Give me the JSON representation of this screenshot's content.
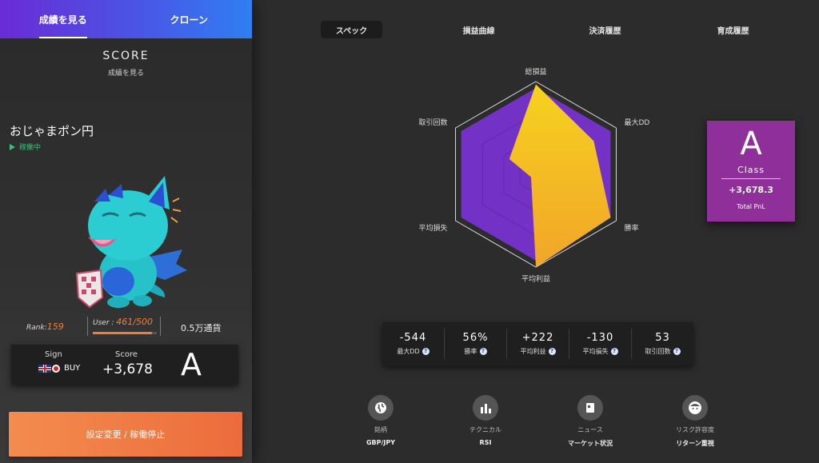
{
  "left_tabs": {
    "tab1": "成績を見る",
    "tab2": "クローン"
  },
  "score_header": {
    "title": "SCORE",
    "subtitle": "成績を見る"
  },
  "bot": {
    "name": "おじゃまポン円",
    "status": "稼働中"
  },
  "rank": {
    "label": "Rank:",
    "value": "159"
  },
  "user": {
    "label": "User : ",
    "value": "461/500",
    "fill_fraction": 0.922
  },
  "currency": "0.5万通貨",
  "sign_card": {
    "sign_label": "Sign",
    "sign_value": "BUY",
    "score_label": "Score",
    "score_value": "+3,678",
    "grade": "A"
  },
  "action_button": "設定変更 / 稼働停止",
  "right_tabs": {
    "spec": "スペック",
    "pnl_curve": "損益曲線",
    "history": "決済履歴",
    "training": "育成履歴"
  },
  "radar": {
    "labels": {
      "top": "総損益",
      "top_right": "最大DD",
      "bottom_right": "勝率",
      "bottom": "平均利益",
      "bottom_left": "平均損失",
      "top_left": "取引回数"
    },
    "values": {
      "top": 0.97,
      "top_right": 0.72,
      "bottom_right": 0.93,
      "bottom": 1.0,
      "bottom_left": 0.06,
      "top_left": 0.33
    },
    "colors": {
      "purple": "#7b33d6",
      "orange": "#f2a52a",
      "yellow": "#f5d21e"
    }
  },
  "class_card": {
    "letter": "A",
    "label": "Class",
    "pnl": "+3,678.3",
    "pnl_label": "Total PnL",
    "color": "#8e2f9a"
  },
  "stats": [
    {
      "value": "-544",
      "label": "最大DD"
    },
    {
      "value": "56%",
      "label": "勝率"
    },
    {
      "value": "+222",
      "label": "平均利益"
    },
    {
      "value": "-130",
      "label": "平均損失"
    },
    {
      "value": "53",
      "label": "取引回数"
    }
  ],
  "info": [
    {
      "label": "銘柄",
      "value": "GBP/JPY",
      "icon": "globe-icon"
    },
    {
      "label": "テクニカル",
      "value": "RSI",
      "icon": "bar-chart-icon"
    },
    {
      "label": "ニュース",
      "value": "マーケット状況",
      "icon": "news-icon"
    },
    {
      "label": "リスク許容度",
      "value": "リターン重視",
      "icon": "face-icon"
    }
  ],
  "accent_colors": {
    "orange": "#f07d3a",
    "green": "#33c07a"
  }
}
